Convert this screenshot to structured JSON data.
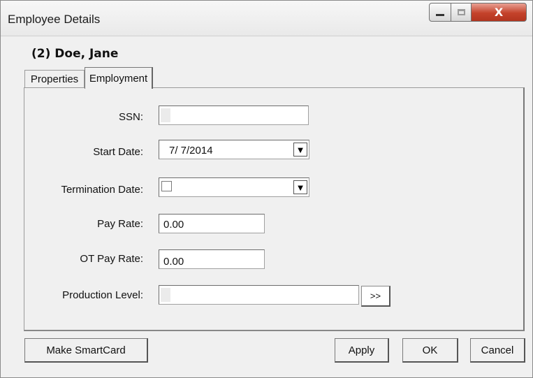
{
  "window": {
    "title": "Employee Details",
    "close_glyph": "X"
  },
  "record": {
    "title": "(2) Doe, Jane"
  },
  "tabs": [
    {
      "label": "Properties",
      "active": false
    },
    {
      "label": "Employment",
      "active": true
    }
  ],
  "form": {
    "ssn": {
      "label": "SSN:",
      "value": ""
    },
    "start_date": {
      "label": "Start Date:",
      "value": "7/ 7/2014",
      "arrow": "▼"
    },
    "termination_date": {
      "label": "Termination Date:",
      "value": "",
      "checked": false,
      "arrow": "▼"
    },
    "pay_rate": {
      "label": "Pay Rate:",
      "value": "0.00"
    },
    "ot_pay_rate": {
      "label": "OT Pay Rate:",
      "value": "0.00"
    },
    "production_level": {
      "label": "Production Level:",
      "value": "",
      "browse_label": ">>"
    }
  },
  "buttons": {
    "make_smartcard": "Make SmartCard",
    "apply": "Apply",
    "ok": "OK",
    "cancel": "Cancel"
  }
}
